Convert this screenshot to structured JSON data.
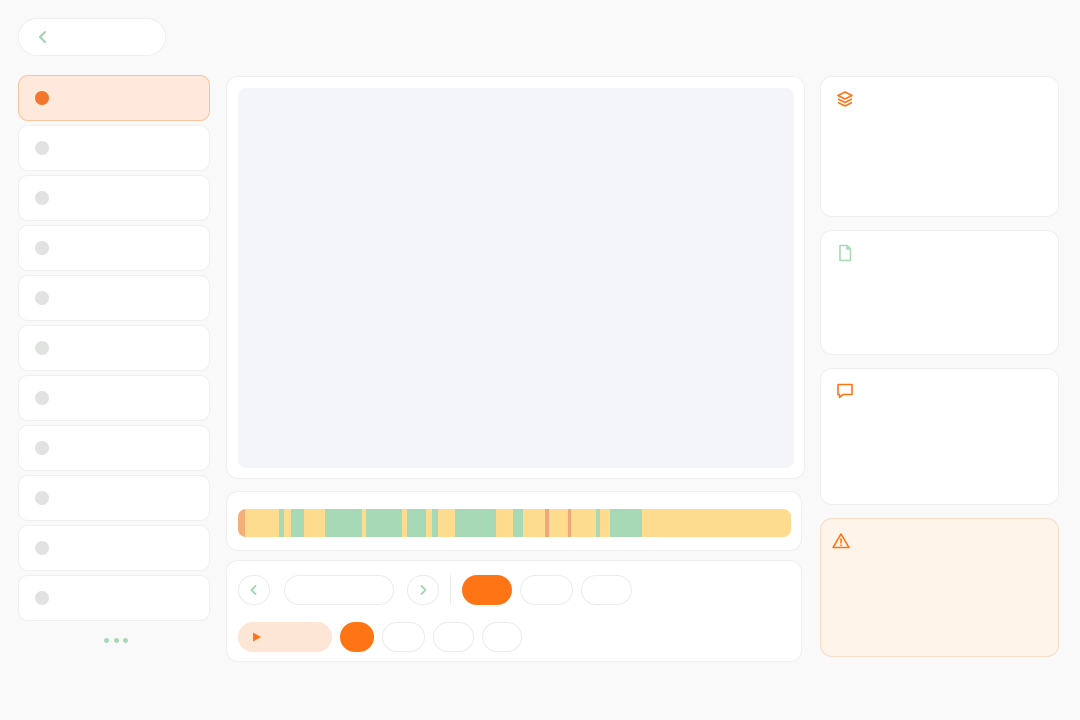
{
  "colors": {
    "accent": "#ff7415",
    "accent_soft": "#ffe9dc",
    "green": "#a8d9b7",
    "yellow": "#fddc8f",
    "warn_bg": "#fff4ea",
    "canvas_bg": "#f4f5f8"
  },
  "header": {
    "back_icon": "chevron-left-icon",
    "back_label": ""
  },
  "sidebar": {
    "items": [
      {
        "label": "",
        "active": true
      },
      {
        "label": "",
        "active": false
      },
      {
        "label": "",
        "active": false
      },
      {
        "label": "",
        "active": false
      },
      {
        "label": "",
        "active": false
      },
      {
        "label": "",
        "active": false
      },
      {
        "label": "",
        "active": false
      },
      {
        "label": "",
        "active": false
      },
      {
        "label": "",
        "active": false
      },
      {
        "label": "",
        "active": false
      },
      {
        "label": "",
        "active": false
      }
    ],
    "more_icon": "more-horizontal-icon"
  },
  "timeline": {
    "segments": [
      {
        "start": 0.0,
        "end": 0.012,
        "color": "#f5b07a"
      },
      {
        "start": 0.012,
        "end": 0.075,
        "color": "#fddc8f"
      },
      {
        "start": 0.075,
        "end": 0.084,
        "color": "#a8d9b7"
      },
      {
        "start": 0.084,
        "end": 0.095,
        "color": "#fddc8f"
      },
      {
        "start": 0.095,
        "end": 0.12,
        "color": "#a8d9b7"
      },
      {
        "start": 0.12,
        "end": 0.158,
        "color": "#fddc8f"
      },
      {
        "start": 0.158,
        "end": 0.225,
        "color": "#a8d9b7"
      },
      {
        "start": 0.225,
        "end": 0.232,
        "color": "#fddc8f"
      },
      {
        "start": 0.232,
        "end": 0.296,
        "color": "#a8d9b7"
      },
      {
        "start": 0.296,
        "end": 0.305,
        "color": "#fddc8f"
      },
      {
        "start": 0.305,
        "end": 0.34,
        "color": "#a8d9b7"
      },
      {
        "start": 0.34,
        "end": 0.35,
        "color": "#fddc8f"
      },
      {
        "start": 0.35,
        "end": 0.362,
        "color": "#a8d9b7"
      },
      {
        "start": 0.362,
        "end": 0.392,
        "color": "#fddc8f"
      },
      {
        "start": 0.392,
        "end": 0.467,
        "color": "#a8d9b7"
      },
      {
        "start": 0.467,
        "end": 0.497,
        "color": "#fddc8f"
      },
      {
        "start": 0.497,
        "end": 0.515,
        "color": "#a8d9b7"
      },
      {
        "start": 0.515,
        "end": 0.555,
        "color": "#fddc8f"
      },
      {
        "start": 0.555,
        "end": 0.562,
        "color": "#f2a77a"
      },
      {
        "start": 0.562,
        "end": 0.597,
        "color": "#fddc8f"
      },
      {
        "start": 0.597,
        "end": 0.603,
        "color": "#f2a77a"
      },
      {
        "start": 0.603,
        "end": 0.648,
        "color": "#fddc8f"
      },
      {
        "start": 0.648,
        "end": 0.655,
        "color": "#a8d9b7"
      },
      {
        "start": 0.655,
        "end": 0.672,
        "color": "#fddc8f"
      },
      {
        "start": 0.672,
        "end": 0.73,
        "color": "#a8d9b7"
      },
      {
        "start": 0.73,
        "end": 1.0,
        "color": "#fddc8f"
      }
    ]
  },
  "controls": {
    "prev_icon": "chevron-left-icon",
    "next_icon": "chevron-right-icon",
    "frame_field": "",
    "row1_pills": [
      "",
      "",
      ""
    ],
    "play_icon": "play-icon",
    "play_label": "",
    "row2_pills": [
      "",
      "",
      "",
      ""
    ]
  },
  "right_cards": [
    {
      "icon": "layers-icon",
      "title": "",
      "body": ""
    },
    {
      "icon": "file-icon",
      "title": "",
      "body": ""
    },
    {
      "icon": "message-icon",
      "title": "",
      "body": ""
    },
    {
      "icon": "warning-icon",
      "title": "",
      "body": ""
    }
  ]
}
